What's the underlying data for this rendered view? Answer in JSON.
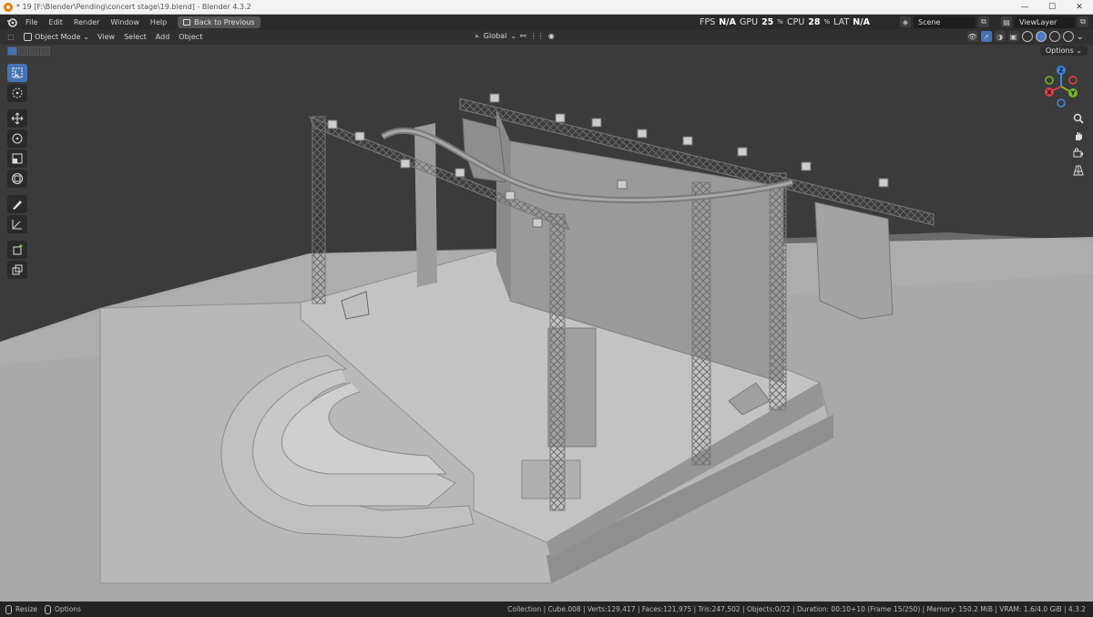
{
  "window": {
    "title": "* 19 [F:\\Blender\\Pending\\concert stage\\19.blend] - Blender 4.3.2",
    "min": "—",
    "max": "☐",
    "close": "✕"
  },
  "topbar": {
    "menus": [
      "File",
      "Edit",
      "Render",
      "Window",
      "Help"
    ],
    "back_button": "Back to Previous",
    "perf": {
      "fps_label": "FPS",
      "fps_value": "N/A",
      "gpu_label": "GPU",
      "gpu_value": "25",
      "gpu_unit": "%",
      "cpu_label": "CPU",
      "cpu_value": "28",
      "cpu_unit": "%",
      "lat_label": "LAT",
      "lat_value": "N/A"
    },
    "scene": "Scene",
    "view_layer": "ViewLayer"
  },
  "viewport_header": {
    "mode": "Object Mode",
    "menus": [
      "View",
      "Select",
      "Add",
      "Object"
    ],
    "orientation": "Global",
    "options": "Options"
  },
  "statusbar": {
    "resize": "Resize",
    "options": "Options",
    "stats": "Collection | Cube.008 | Verts:129,417 | Faces:121,975 | Tris:247,502 | Objects:0/22 | Duration: 00:10+10 (Frame 15/250) | Memory: 150.2 MiB | VRAM: 1.6/4.0 GiB | 4.3.2"
  },
  "gizmo": {
    "z_label": "Z",
    "y_label": "Y",
    "x_label": "X",
    "colors": {
      "x": "#e0404a",
      "y": "#7ab52c",
      "z": "#3d86e0"
    }
  },
  "icons": {
    "tools": [
      "select-box-icon",
      "cursor-icon",
      "move-icon",
      "rotate-icon",
      "scale-icon",
      "transform-icon",
      "annotate-icon",
      "measure-icon",
      "add-cube-icon",
      "extrude-icon"
    ],
    "nav": [
      "zoom-icon",
      "pan-icon",
      "camera-view-icon",
      "ortho-grid-icon"
    ]
  },
  "colors": {
    "active_blue": "#4772b3",
    "viewport_bg": "#3b3b3b"
  }
}
